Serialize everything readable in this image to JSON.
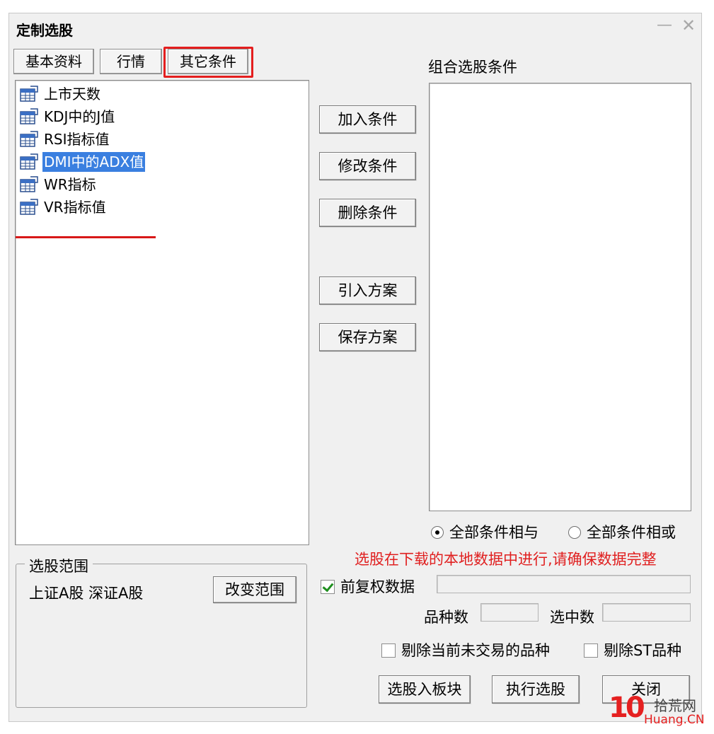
{
  "window": {
    "title": "定制选股",
    "minimize_glyph": "—",
    "close_glyph": "✕"
  },
  "tabs": [
    {
      "label": "基本资料"
    },
    {
      "label": "行情"
    },
    {
      "label": "其它条件"
    }
  ],
  "highlight_color": "#e41e1e",
  "condition_list": [
    {
      "label": "上市天数",
      "icon": "table-icon"
    },
    {
      "label": "KDJ中的J值",
      "icon": "table-icon"
    },
    {
      "label": "RSI指标值",
      "icon": "table-icon"
    },
    {
      "label": "DMI中的ADX值",
      "icon": "table-icon",
      "selected": true
    },
    {
      "label": "WR指标",
      "icon": "table-icon"
    },
    {
      "label": "VR指标值",
      "icon": "table-icon"
    }
  ],
  "actions": {
    "add": "加入条件",
    "modify": "修改条件",
    "delete": "删除条件",
    "import": "引入方案",
    "save": "保存方案"
  },
  "combo": {
    "label": "组合选股条件"
  },
  "logic": {
    "and_label": "全部条件相与",
    "or_label": "全部条件相或",
    "selected": "and"
  },
  "warning": "选股在下载的本地数据中进行,请确保数据完整",
  "scope": {
    "legend": "选股范围",
    "value": "上证A股 深证A股",
    "change_button": "改变范围"
  },
  "forward_adjust": {
    "label": "前复权数据",
    "checked": true
  },
  "counts": {
    "variety_label": "品种数",
    "selected_label": "选中数"
  },
  "exclusions": {
    "untraded_label": "剔除当前未交易的品种",
    "untraded_checked": false,
    "st_label": "剔除ST品种",
    "st_checked": false
  },
  "bottom_buttons": {
    "to_block": "选股入板块",
    "execute": "执行选股",
    "close": "关闭"
  },
  "watermark": {
    "logo": "10",
    "site_cn": "拾荒网",
    "site_en": "Huang.CN"
  }
}
